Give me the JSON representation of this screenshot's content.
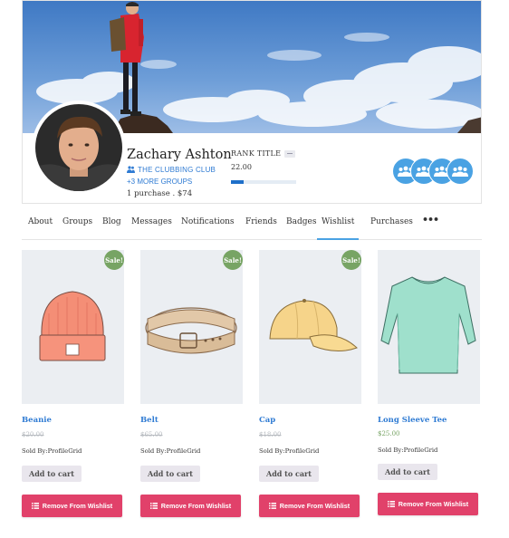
{
  "profile": {
    "name": "Zachary Ashton",
    "group_name": "THE CLUBBING CLUB",
    "more_groups": "+3 MORE GROUPS",
    "purchase_summary": "1 purchase . $74",
    "rank_title": "RANK TITLE",
    "rank_points": "22.00",
    "rank_progress": 0.2
  },
  "tabs": [
    "About",
    "Groups",
    "Blog",
    "Messages",
    "Notifications",
    "Friends",
    "Badges",
    "Wishlist",
    "Purchases"
  ],
  "active_tab": "Wishlist",
  "more_tabs_icon": "•••",
  "sale_label": "Sale!",
  "seller_prefix": "Sold By:",
  "products": [
    {
      "title": "Beanie",
      "old_price": "$20.00",
      "price": "",
      "seller": "ProfileGrid",
      "on_sale": true,
      "image": "beanie-image",
      "cart_label": "Add to cart",
      "remove_label": "Remove From Wishlist"
    },
    {
      "title": "Belt",
      "old_price": "$65.00",
      "price": "",
      "seller": "ProfileGrid",
      "on_sale": true,
      "image": "belt-image",
      "cart_label": "Add to cart",
      "remove_label": "Remove From Wishlist"
    },
    {
      "title": "Cap",
      "old_price": "$18.00",
      "price": "",
      "seller": "ProfileGrid",
      "on_sale": true,
      "image": "cap-image",
      "cart_label": "Add to cart",
      "remove_label": "Remove From Wishlist"
    },
    {
      "title": "Long Sleeve Tee",
      "old_price": "",
      "price": "$25.00",
      "seller": "ProfileGrid",
      "on_sale": false,
      "image": "long-sleeve-tee-image",
      "cart_label": "Add to cart",
      "remove_label": "Remove From Wishlist"
    }
  ],
  "colors": {
    "link_blue": "#2f7bd3",
    "sale_green": "#77a464",
    "remove_pink": "#e1416a",
    "group_icon_blue": "#4aa2e3",
    "rank_bar_blue": "#1e6fc9"
  }
}
